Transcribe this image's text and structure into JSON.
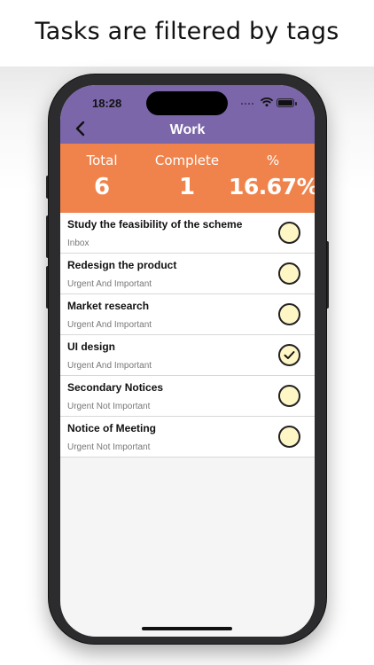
{
  "caption": "Tasks are filtered by tags",
  "status_bar": {
    "time": "18:28"
  },
  "nav": {
    "back_icon": "chevron-left-icon",
    "title": "Work"
  },
  "colors": {
    "nav_bg": "#7b66aa",
    "stats_bg": "#f0834c",
    "check_fill": "#fff6c6"
  },
  "stats": {
    "total_label": "Total",
    "total_value": "6",
    "complete_label": "Complete",
    "complete_value": "1",
    "percent_label": "%",
    "percent_value": "16.67%"
  },
  "tasks": [
    {
      "title": "Study the feasibility of the scheme",
      "tag": "Inbox",
      "done": false
    },
    {
      "title": "Redesign the product",
      "tag": "Urgent And Important",
      "done": false
    },
    {
      "title": "Market research",
      "tag": "Urgent And Important",
      "done": false
    },
    {
      "title": "UI design",
      "tag": "Urgent And Important",
      "done": true
    },
    {
      "title": "Secondary Notices",
      "tag": "Urgent Not Important",
      "done": false
    },
    {
      "title": "Notice of Meeting",
      "tag": "Urgent Not Important",
      "done": false
    }
  ]
}
